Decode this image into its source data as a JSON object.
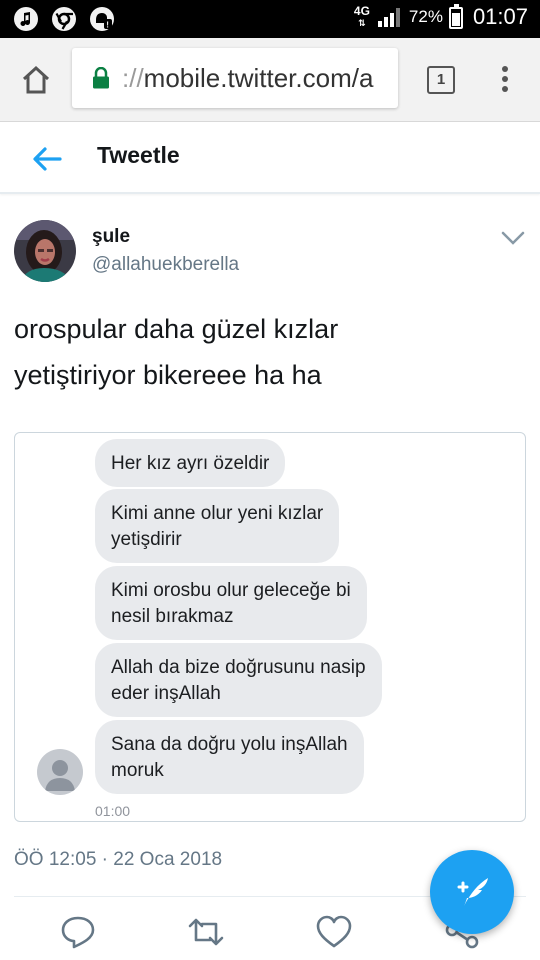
{
  "status_bar": {
    "network": "4G",
    "battery_percent": "72%",
    "time": "01:07",
    "battery_level": 0.72,
    "left_icons": [
      "music-icon",
      "chrome-icon",
      "notification-icon"
    ]
  },
  "browser": {
    "url_scheme": "://",
    "url_host": "mobile.twitter.com/a",
    "tab_count": "1"
  },
  "header": {
    "title": "Tweetle"
  },
  "tweet": {
    "author_name": "şule",
    "author_handle": "@allahuekberella",
    "text_line1": "orospular daha güzel kızlar",
    "text_line2": "yetiştiriyor bikereee ha ha",
    "timestamp": "ÖÖ 12:05 · 22 Oca 2018"
  },
  "chat_image": {
    "messages": [
      {
        "line1": "Her kız ayrı özeldir",
        "line2": ""
      },
      {
        "line1": "Kimi anne olur yeni kızlar",
        "line2": "yetişdirir"
      },
      {
        "line1": "Kimi orosbu olur geleceğe bi",
        "line2": "nesil bırakmaz"
      },
      {
        "line1": "Allah da bize doğrusunu nasip",
        "line2": "eder inşAllah"
      },
      {
        "line1": "Sana da doğru yolu inşAllah",
        "line2": "moruk"
      }
    ],
    "time": "01:00"
  },
  "colors": {
    "twitter_blue": "#1da1f2",
    "secondary_text": "#657786",
    "bubble_bg": "#e8eaed"
  }
}
